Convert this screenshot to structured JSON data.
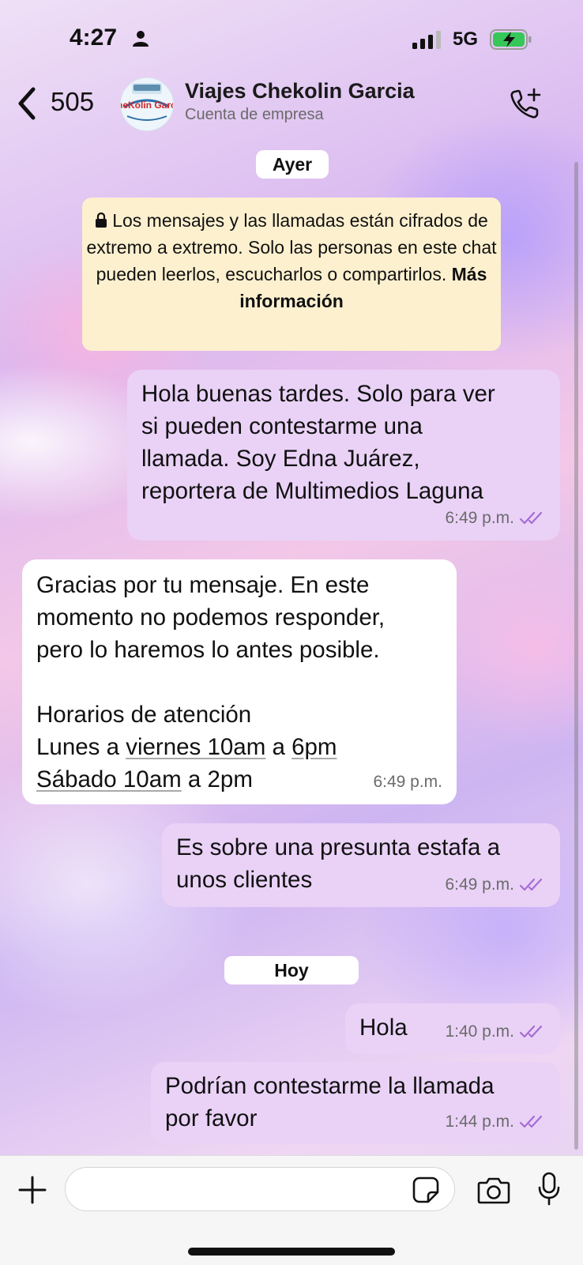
{
  "status_bar": {
    "time": "4:27",
    "network": "5G"
  },
  "header": {
    "back_count": "505",
    "title": "Viajes Chekolin Garcia",
    "subtitle": "Cuenta de empresa",
    "avatar_logo_text": "CheKolin Garcia"
  },
  "dates": {
    "yesterday": "Ayer",
    "today": "Hoy"
  },
  "system_message": {
    "text": "Los mensajes y las llamadas están cifrados de extremo a extremo. Solo las personas en este chat pueden leerlos, escucharlos o compartirlos.",
    "link": "Más información"
  },
  "messages": [
    {
      "direction": "out",
      "text_lines": [
        "Hola buenas tardes. Solo para ver",
        "si pueden contestarme una",
        "llamada. Soy Edna Juárez,",
        "reportera de Multimedios Laguna"
      ],
      "time": "6:49 p.m.",
      "status": "read"
    },
    {
      "direction": "in",
      "text_lines": [
        "Gracias por tu mensaje. En este",
        "momento no podemos responder,",
        "pero lo haremos lo antes posible.",
        "",
        "Horarios de atención"
      ],
      "hours": {
        "l1_a": "Lunes a ",
        "l1_b": "viernes 10am",
        "l1_c": " a ",
        "l1_d": "6pm",
        "l2_a": "Sábado 10am",
        "l2_b": " a 2pm"
      },
      "time": "6:49 p.m."
    },
    {
      "direction": "out",
      "text_lines": [
        "Es sobre una presunta estafa a",
        "unos clientes"
      ],
      "time": "6:49 p.m.",
      "status": "read"
    },
    {
      "direction": "out",
      "text_lines": [
        "Hola"
      ],
      "time": "1:40 p.m.",
      "status": "read"
    },
    {
      "direction": "out",
      "text_lines": [
        "Podrían contestarme la llamada",
        "por favor"
      ],
      "time": "1:44 p.m.",
      "status": "read"
    }
  ],
  "colors": {
    "outgoing_bubble": "#ead2f7",
    "incoming_bubble": "#ffffff",
    "read_ticks": "#a56cd3",
    "system_bg": "#fcf0cf"
  },
  "icons": [
    "person-icon",
    "signal-icon",
    "charging-battery-icon",
    "back-chevron-icon",
    "add-call-icon",
    "plus-icon",
    "sticker-icon",
    "camera-icon",
    "microphone-icon"
  ]
}
